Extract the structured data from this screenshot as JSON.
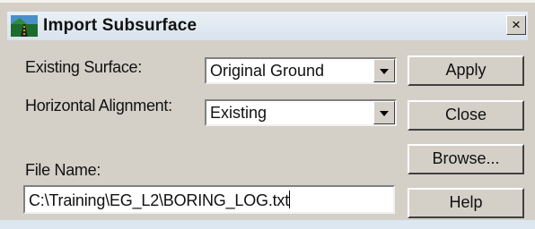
{
  "dialog": {
    "title": "Import Subsurface",
    "close_label": "×"
  },
  "form": {
    "existing_surface_label": "Existing Surface:",
    "existing_surface_value": "Original Ground",
    "horizontal_alignment_label": "Horizontal Alignment:",
    "horizontal_alignment_value": "Existing",
    "file_name_label": "File Name:",
    "file_name_value": "C:\\Training\\EG_L2\\BORING_LOG.txt"
  },
  "buttons": {
    "apply": "Apply",
    "close": "Close",
    "browse": "Browse...",
    "help": "Help"
  },
  "icons": {
    "app": "road-terrain-icon",
    "dropdown": "chevron-down-icon"
  }
}
